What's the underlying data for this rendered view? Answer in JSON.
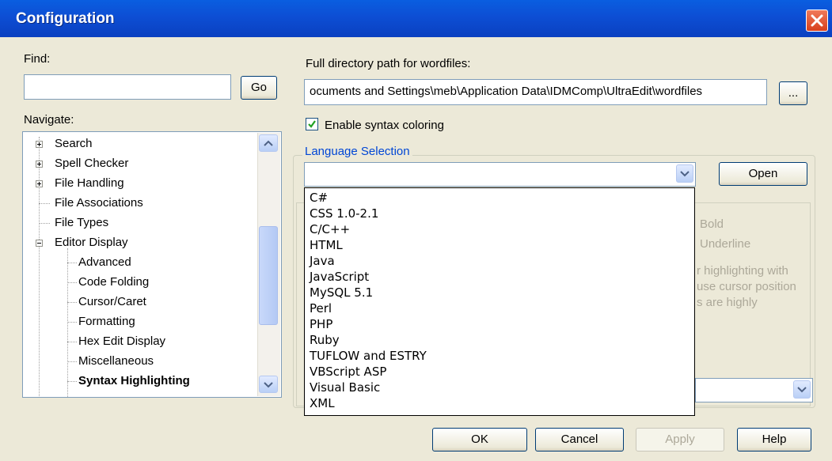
{
  "window": {
    "title": "Configuration"
  },
  "find": {
    "label": "Find:",
    "value": "",
    "go_label": "Go"
  },
  "navigate": {
    "label": "Navigate:",
    "items": [
      {
        "label": "Search"
      },
      {
        "label": "Spell Checker"
      },
      {
        "label": "File Handling"
      },
      {
        "label": "File Associations"
      },
      {
        "label": "File Types"
      },
      {
        "label": "Editor Display"
      },
      {
        "label": "Advanced"
      },
      {
        "label": "Code Folding"
      },
      {
        "label": "Cursor/Caret"
      },
      {
        "label": "Formatting"
      },
      {
        "label": "Hex Edit Display"
      },
      {
        "label": "Miscellaneous"
      },
      {
        "label": "Syntax Highlighting"
      }
    ],
    "selected": "Syntax Highlighting"
  },
  "wordfiles": {
    "label": "Full directory path for wordfiles:",
    "path": "ocuments and Settings\\meb\\Application Data\\IDMComp\\UltraEdit\\wordfiles",
    "browse_label": "..."
  },
  "syntax": {
    "enable_label": "Enable syntax coloring",
    "enabled": true
  },
  "language": {
    "group_title": "Language Selection",
    "selected": "",
    "open_label": "Open",
    "options": [
      "C#",
      "CSS 1.0-2.1",
      "C/C++",
      "HTML",
      "Java",
      "JavaScript",
      "MySQL 5.1",
      "Perl",
      "PHP",
      "Ruby",
      "TUFLOW and ESTRY",
      "VBScript ASP",
      "Visual Basic",
      "XML"
    ]
  },
  "hidden_fragments": {
    "bold": "Bold",
    "underline": "Underline",
    "line1": "r highlighting with",
    "line2": "use cursor position",
    "line3": "s are highly"
  },
  "footer": {
    "ok": "OK",
    "cancel": "Cancel",
    "apply": "Apply",
    "help": "Help"
  },
  "colors": {
    "titlebar": "#0d4ed4",
    "dialog_bg": "#ece9d8",
    "group_title": "#0046d5",
    "close_button": "#d8401c"
  }
}
